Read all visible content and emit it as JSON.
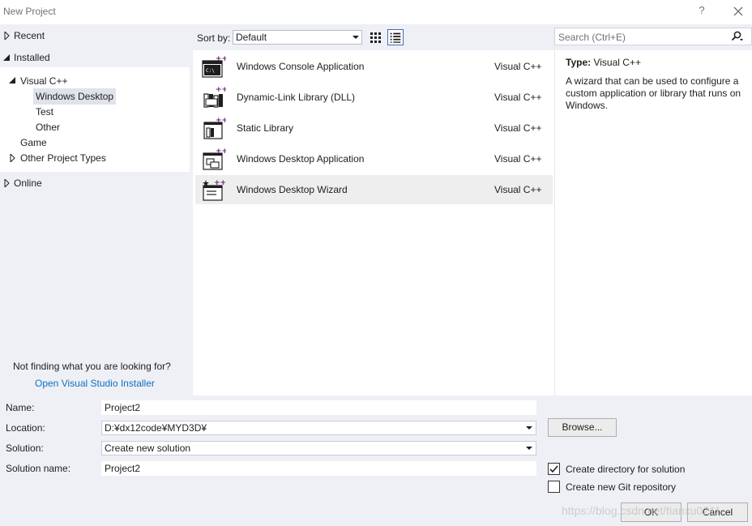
{
  "window": {
    "title": "New Project",
    "help_glyph": "?",
    "close_icon": "close-icon"
  },
  "tree": {
    "recent": "Recent",
    "installed": "Installed",
    "visual_cpp": "Visual C++",
    "windows_desktop": "Windows Desktop",
    "test": "Test",
    "other": "Other",
    "game": "Game",
    "other_project_types": "Other Project Types",
    "online": "Online"
  },
  "hint": {
    "text": "Not finding what you are looking for?",
    "link": "Open Visual Studio Installer"
  },
  "sort": {
    "label": "Sort by:",
    "value": "Default"
  },
  "search": {
    "placeholder": "Search (Ctrl+E)"
  },
  "templates": [
    {
      "name": "Windows Console Application",
      "lang": "Visual C++",
      "icon": "console-app-icon"
    },
    {
      "name": "Dynamic-Link Library (DLL)",
      "lang": "Visual C++",
      "icon": "dll-icon"
    },
    {
      "name": "Static Library",
      "lang": "Visual C++",
      "icon": "static-library-icon"
    },
    {
      "name": "Windows Desktop Application",
      "lang": "Visual C++",
      "icon": "desktop-app-icon"
    },
    {
      "name": "Windows Desktop Wizard",
      "lang": "Visual C++",
      "icon": "desktop-wizard-icon",
      "selected": true
    }
  ],
  "details": {
    "type_label": "Type:",
    "type_value": "Visual C++",
    "description": "A wizard that can be used to configure a custom application or library that runs on Windows."
  },
  "form": {
    "name_label": "Name:",
    "name_value": "Project2",
    "location_label": "Location:",
    "location_value": "D:¥dx12code¥MYD3D¥",
    "solution_label": "Solution:",
    "solution_value": "Create new solution",
    "solution_name_label": "Solution name:",
    "solution_name_value": "Project2",
    "browse": "Browse...",
    "create_directory": "Create directory for solution",
    "create_directory_checked": true,
    "create_git": "Create new Git repository",
    "create_git_checked": false,
    "ok": "OK",
    "cancel": "Cancel"
  },
  "watermark": "https://blog.csdn.net/tianxu0211",
  "colors": {
    "accent": "#0e70c0",
    "cpp_purple": "#68217a",
    "panel_bg": "#eef0f6"
  }
}
